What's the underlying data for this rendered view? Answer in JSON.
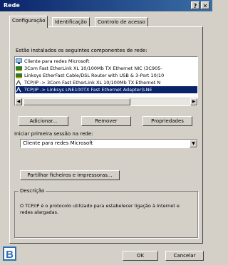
{
  "window": {
    "title": "Rede",
    "help_button": "?",
    "close_button": "✕"
  },
  "tabs": [
    {
      "label": "Configuração",
      "active": true
    },
    {
      "label": "Identificação",
      "active": false
    },
    {
      "label": "Controlo de acesso",
      "active": false
    }
  ],
  "components": {
    "heading": "Estão instalados os seguintes componentes de rede:",
    "items": [
      {
        "icon": "client-icon",
        "label": "Cliente para redes Microsoft",
        "selected": false
      },
      {
        "icon": "network-card-icon",
        "label": "3Com Fast EtherLink XL 10/100Mb TX Ethernet NIC (3C905-",
        "selected": false
      },
      {
        "icon": "network-card-icon",
        "label": "Linksys EtherFast Cable/DSL Router with USB & 3-Port 10/10",
        "selected": false
      },
      {
        "icon": "protocol-icon",
        "label": "TCP/IP -> 3Com Fast EtherLink XL 10/100Mb TX Ethernet N",
        "selected": false
      },
      {
        "icon": "protocol-icon",
        "label": "TCP/IP -> Linksys LNE100TX Fast Ethernet Adapter(LNE",
        "selected": true
      }
    ]
  },
  "buttons": {
    "add": "Adicionar...",
    "remove": "Remover",
    "properties": "Propriedades",
    "sharing": "Partilhar ficheiros e impressoras...",
    "ok": "OK",
    "cancel": "Cancelar"
  },
  "logon": {
    "label": "Iniciar primeira sessão na rede:",
    "value": "Cliente para redes Microsoft"
  },
  "description": {
    "label": "Descrição",
    "text": "O TCP/IP é o protocolo utilizado para estabelecer ligação à Internet e redes alargadas."
  },
  "badge": "B",
  "colors": {
    "titlebar_start": "#0a246a",
    "titlebar_end": "#3a6ea5",
    "selection": "#0a246a",
    "badge": "#2f6db5"
  }
}
